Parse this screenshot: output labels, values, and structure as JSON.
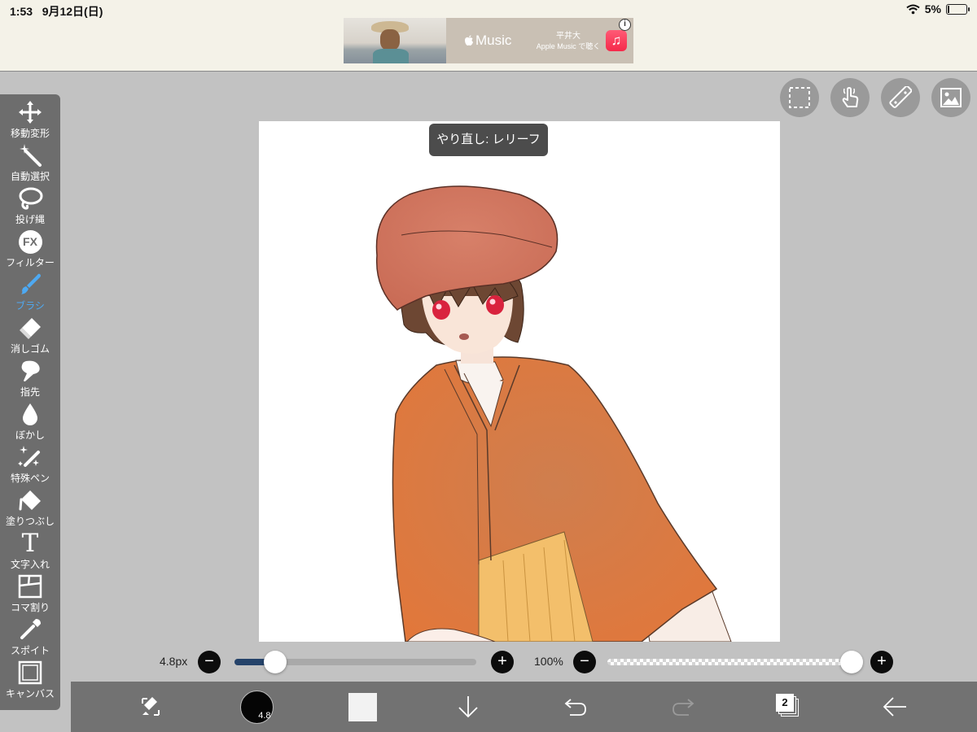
{
  "status": {
    "time": "1:53",
    "date": "9月12日(日)",
    "battery": "5%",
    "battery_level": 0.05
  },
  "ad": {
    "brand": "Music",
    "artist": "平井大",
    "cta": "Apple Music で聴く",
    "info": "i"
  },
  "tools": [
    {
      "label": "移動変形",
      "icon": "move-icon"
    },
    {
      "label": "自動選択",
      "icon": "magic-wand-icon"
    },
    {
      "label": "投げ縄",
      "icon": "lasso-icon"
    },
    {
      "label": "フィルター",
      "icon": "fx-icon",
      "glyph": "FX"
    },
    {
      "label": "ブラシ",
      "icon": "brush-icon",
      "active": true
    },
    {
      "label": "消しゴム",
      "icon": "eraser-icon"
    },
    {
      "label": "指先",
      "icon": "smudge-icon"
    },
    {
      "label": "ぼかし",
      "icon": "blur-drop-icon"
    },
    {
      "label": "特殊ペン",
      "icon": "special-pen-icon"
    },
    {
      "label": "塗りつぶし",
      "icon": "fill-bucket-icon"
    },
    {
      "label": "文字入れ",
      "icon": "text-icon",
      "glyph": "T"
    },
    {
      "label": "コマ割り",
      "icon": "frame-divider-icon"
    },
    {
      "label": "スポイト",
      "icon": "eyedropper-icon"
    },
    {
      "label": "キャンバス",
      "icon": "canvas-icon"
    }
  ],
  "top_buttons": [
    "selection-icon",
    "touch-icon",
    "ruler-icon",
    "material-icon"
  ],
  "toast": "やり直し: レリーフ",
  "brush": {
    "size_label": "4.8px",
    "size_fraction": 0.17,
    "color_badge": "4.8"
  },
  "opacity": {
    "label": "100%",
    "value_fraction": 1.0
  },
  "controls": {
    "minus": "−",
    "plus": "+"
  },
  "bottom": {
    "layers_count": "2"
  },
  "colors": {
    "accent": "#4ea9f2",
    "toolbar": "#6d6d6d",
    "bottom_bar": "#727272",
    "workspace": "#c2c2c2",
    "slider_fill": "#25436a"
  }
}
